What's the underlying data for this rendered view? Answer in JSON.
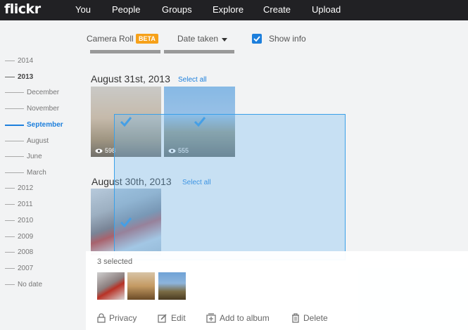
{
  "topbar": {
    "logo": "flickr",
    "nav": [
      "You",
      "People",
      "Groups",
      "Explore",
      "Create",
      "Upload"
    ]
  },
  "subnav": {
    "camera_roll": "Camera Roll",
    "beta": "BETA",
    "date_taken": "Date taken",
    "show_info": "Show info",
    "show_info_checked": true
  },
  "timeline": [
    {
      "label": "2014",
      "kind": "year"
    },
    {
      "label": "2013",
      "kind": "year",
      "bold": true
    },
    {
      "label": "December",
      "kind": "month"
    },
    {
      "label": "November",
      "kind": "month"
    },
    {
      "label": "September",
      "kind": "month",
      "active": true
    },
    {
      "label": "August",
      "kind": "month"
    },
    {
      "label": "June",
      "kind": "month"
    },
    {
      "label": "March",
      "kind": "month"
    },
    {
      "label": "2012",
      "kind": "year"
    },
    {
      "label": "2011",
      "kind": "year"
    },
    {
      "label": "2010",
      "kind": "year"
    },
    {
      "label": "2009",
      "kind": "year"
    },
    {
      "label": "2008",
      "kind": "year"
    },
    {
      "label": "2007",
      "kind": "year"
    },
    {
      "label": "No date",
      "kind": "year"
    }
  ],
  "groups": [
    {
      "date": "August 31st, 2013",
      "select_all": "Select all",
      "photos": [
        {
          "views": "598",
          "selected": true,
          "subject": "sunset"
        },
        {
          "views": "555",
          "selected": true,
          "subject": "cactus"
        }
      ]
    },
    {
      "date": "August 30th, 2013",
      "select_all": "Select all",
      "photos": [
        {
          "views": "",
          "selected": true,
          "subject": "motorbike"
        }
      ]
    }
  ],
  "selection_panel": {
    "count_label": "3 selected",
    "actions": {
      "privacy": "Privacy",
      "edit": "Edit",
      "add_to_album": "Add to album",
      "delete": "Delete"
    }
  },
  "colors": {
    "accent": "#1d7fdc",
    "beta": "#f6a11a",
    "topbar": "#212124"
  }
}
